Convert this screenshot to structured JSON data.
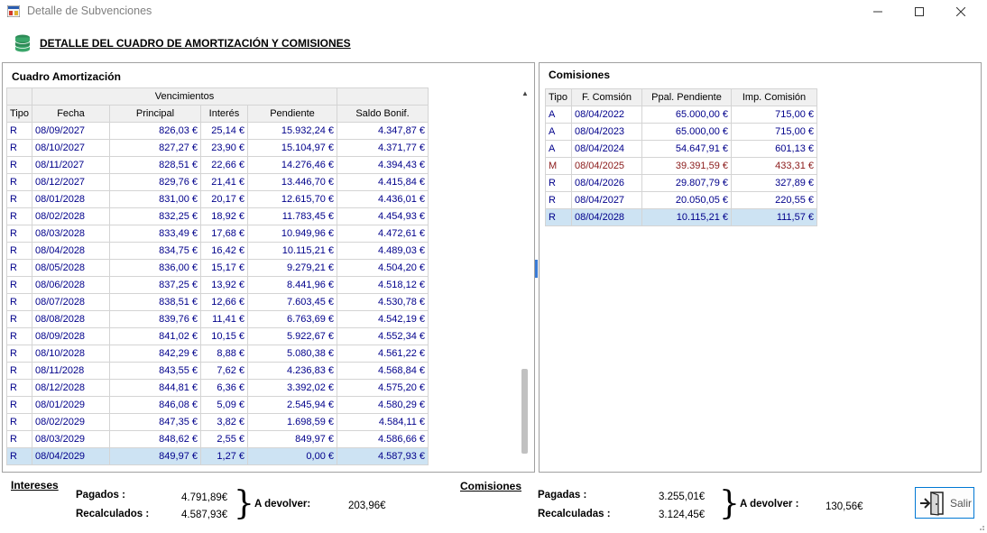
{
  "window": {
    "title": "Detalle de Subvenciones",
    "heading": "DETALLE DEL CUADRO DE AMORTIZACIÓN Y COMISIONES"
  },
  "amortizacion": {
    "title": "Cuadro Amortización",
    "group_header": "Vencimientos",
    "columns": [
      "Tipo",
      "Fecha",
      "Principal",
      "Interés",
      "Pendiente",
      "Saldo Bonif."
    ],
    "rows": [
      [
        "R",
        "08/09/2027",
        "826,03 €",
        "25,14 €",
        "15.932,24 €",
        "4.347,87 €"
      ],
      [
        "R",
        "08/10/2027",
        "827,27 €",
        "23,90 €",
        "15.104,97 €",
        "4.371,77 €"
      ],
      [
        "R",
        "08/11/2027",
        "828,51 €",
        "22,66 €",
        "14.276,46 €",
        "4.394,43 €"
      ],
      [
        "R",
        "08/12/2027",
        "829,76 €",
        "21,41 €",
        "13.446,70 €",
        "4.415,84 €"
      ],
      [
        "R",
        "08/01/2028",
        "831,00 €",
        "20,17 €",
        "12.615,70 €",
        "4.436,01 €"
      ],
      [
        "R",
        "08/02/2028",
        "832,25 €",
        "18,92 €",
        "11.783,45 €",
        "4.454,93 €"
      ],
      [
        "R",
        "08/03/2028",
        "833,49 €",
        "17,68 €",
        "10.949,96 €",
        "4.472,61 €"
      ],
      [
        "R",
        "08/04/2028",
        "834,75 €",
        "16,42 €",
        "10.115,21 €",
        "4.489,03 €"
      ],
      [
        "R",
        "08/05/2028",
        "836,00 €",
        "15,17 €",
        "9.279,21 €",
        "4.504,20 €"
      ],
      [
        "R",
        "08/06/2028",
        "837,25 €",
        "13,92 €",
        "8.441,96 €",
        "4.518,12 €"
      ],
      [
        "R",
        "08/07/2028",
        "838,51 €",
        "12,66 €",
        "7.603,45 €",
        "4.530,78 €"
      ],
      [
        "R",
        "08/08/2028",
        "839,76 €",
        "11,41 €",
        "6.763,69 €",
        "4.542,19 €"
      ],
      [
        "R",
        "08/09/2028",
        "841,02 €",
        "10,15 €",
        "5.922,67 €",
        "4.552,34 €"
      ],
      [
        "R",
        "08/10/2028",
        "842,29 €",
        "8,88 €",
        "5.080,38 €",
        "4.561,22 €"
      ],
      [
        "R",
        "08/11/2028",
        "843,55 €",
        "7,62 €",
        "4.236,83 €",
        "4.568,84 €"
      ],
      [
        "R",
        "08/12/2028",
        "844,81 €",
        "6,36 €",
        "3.392,02 €",
        "4.575,20 €"
      ],
      [
        "R",
        "08/01/2029",
        "846,08 €",
        "5,09 €",
        "2.545,94 €",
        "4.580,29 €"
      ],
      [
        "R",
        "08/02/2029",
        "847,35 €",
        "3,82 €",
        "1.698,59 €",
        "4.584,11 €"
      ],
      [
        "R",
        "08/03/2029",
        "848,62 €",
        "2,55 €",
        "849,97 €",
        "4.586,66 €"
      ],
      [
        "R",
        "08/04/2029",
        "849,97 €",
        "1,27 €",
        "0,00 €",
        "4.587,93 €"
      ]
    ],
    "selected_row": 19
  },
  "comisiones": {
    "title": "Comisiones",
    "columns": [
      "Tipo",
      "F. Comsión",
      "Ppal. Pendiente",
      "Imp. Comisión"
    ],
    "rows": [
      [
        "A",
        "08/04/2022",
        "65.000,00 €",
        "715,00 €"
      ],
      [
        "A",
        "08/04/2023",
        "65.000,00 €",
        "715,00 €"
      ],
      [
        "A",
        "08/04/2024",
        "54.647,91 €",
        "601,13 €"
      ],
      [
        "M",
        "08/04/2025",
        "39.391,59 €",
        "433,31 €"
      ],
      [
        "R",
        "08/04/2026",
        "29.807,79 €",
        "327,89 €"
      ],
      [
        "R",
        "08/04/2027",
        "20.050,05 €",
        "220,55 €"
      ],
      [
        "R",
        "08/04/2028",
        "10.115,21 €",
        "111,57 €"
      ]
    ],
    "highlight_row": 3,
    "selected_row": 6
  },
  "footer": {
    "intereses": {
      "heading": "Intereses",
      "pagados_label": "Pagados :",
      "pagados_value": "4.791,89€",
      "recalculados_label": "Recalculados :",
      "recalculados_value": "4.587,93€",
      "devolver_label": "A devolver:",
      "devolver_value": "203,96€"
    },
    "comisiones": {
      "heading": "Comisiones",
      "pagadas_label": "Pagadas :",
      "pagadas_value": "3.255,01€",
      "recalculadas_label": "Recalculadas :",
      "recalculadas_value": "3.124,45€",
      "devolver_label": "A devolver :",
      "devolver_value": "130,56€"
    },
    "exit_label": "Salir"
  }
}
